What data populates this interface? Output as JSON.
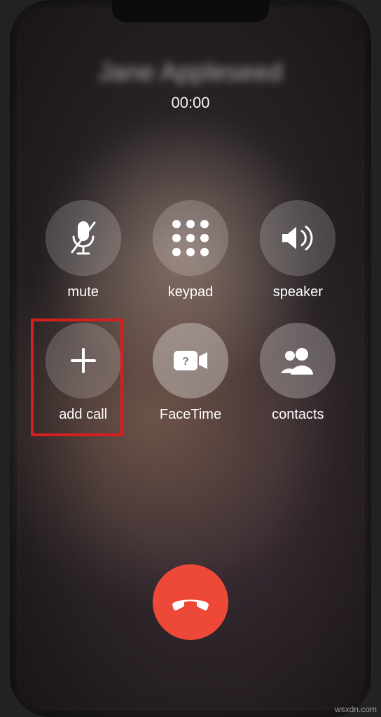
{
  "caller": {
    "name": "Jane Appleseed",
    "timer": "00:00"
  },
  "buttons": {
    "mute": {
      "label": "mute"
    },
    "keypad": {
      "label": "keypad"
    },
    "speaker": {
      "label": "speaker"
    },
    "addcall": {
      "label": "add call"
    },
    "facetime": {
      "label": "FaceTime"
    },
    "contacts": {
      "label": "contacts"
    }
  },
  "colors": {
    "endcall": "#ee4839",
    "highlight": "#d61f1f"
  },
  "watermark": "wsxdn.com"
}
